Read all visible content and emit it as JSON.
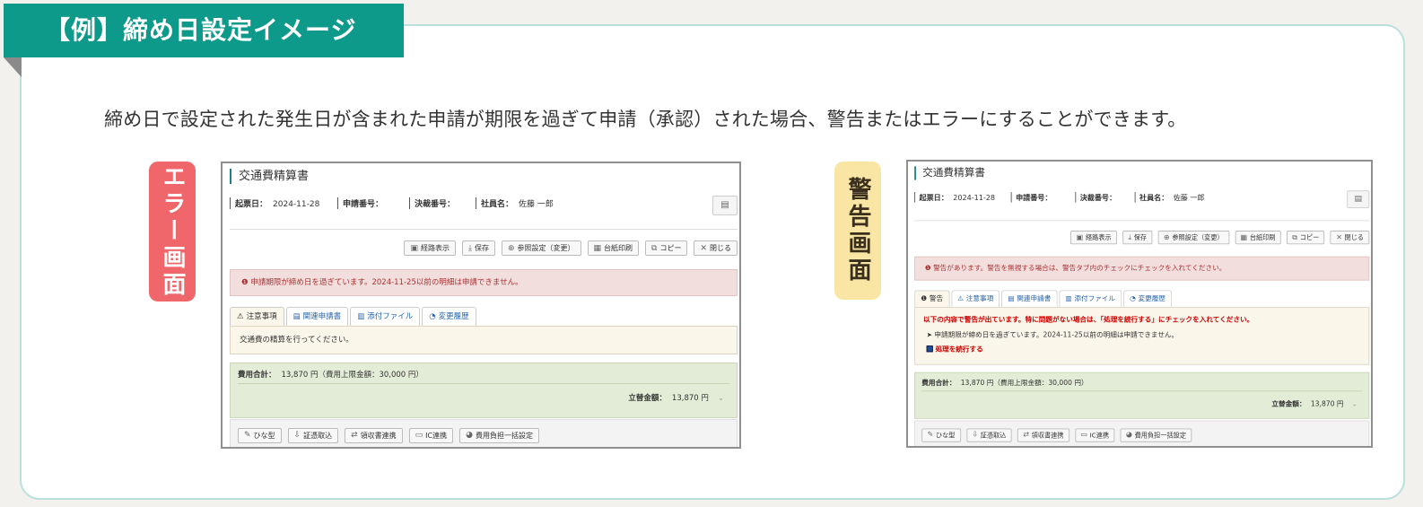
{
  "heading": "【例】締め日設定イメージ",
  "description": "締め日で設定された発生日が含まれた申請が期限を過ぎて申請（承認）された場合、警告またはエラーにすることができます。",
  "tags": {
    "error": "エラー画面",
    "warning": "警告画面"
  },
  "form": {
    "title": "交通費精算書",
    "meta": [
      {
        "label": "起票日：",
        "value": "2024-11-28"
      },
      {
        "label": "申請番号：",
        "value": ""
      },
      {
        "label": "決裁番号：",
        "value": ""
      },
      {
        "label": "社員名：",
        "value": "佐藤 一郎"
      }
    ],
    "toolbar": [
      "経路表示",
      "保存",
      "参照設定（変更）",
      "台紙印刷",
      "コピー",
      "閉じる"
    ],
    "totals": {
      "sum_label": "費用合計：",
      "sum_value": "13,870 円（費用上限金額：30,000 円）",
      "advance_label": "立替金額：",
      "advance_value": "13,870 円"
    },
    "bottom_buttons": [
      "ひな型",
      "証憑取込",
      "領収書連携",
      "IC連携",
      "費用負担一括設定"
    ]
  },
  "error_screen": {
    "alert": "申請期限が締め日を過ぎています。2024-11-25以前の明細は申請できません。",
    "tabs": [
      "注意事項",
      "関連申請書",
      "添付ファイル",
      "変更履歴"
    ],
    "note": "交通費の精算を行ってください。"
  },
  "warning_screen": {
    "alert": "警告があります。警告を無視する場合は、警告タブ内のチェックにチェックを入れてください。",
    "tabs": [
      "警告",
      "注意事項",
      "関連申請書",
      "添付ファイル",
      "変更履歴"
    ],
    "note_heading": "以下の内容で警告が出ています。特に問題がない場合は、「処理を続行する」にチェックを入れてください。",
    "note_line": "申請期限が締め日を過ぎています。2024-11-25以前の明細は申請できません。",
    "continue_label": "処理を続行する"
  },
  "colors": {
    "ribbon": "#0d9a8b",
    "card_border": "#b9e0da",
    "error_tag": "#f0676b",
    "warning_tag": "#fae6a4"
  }
}
